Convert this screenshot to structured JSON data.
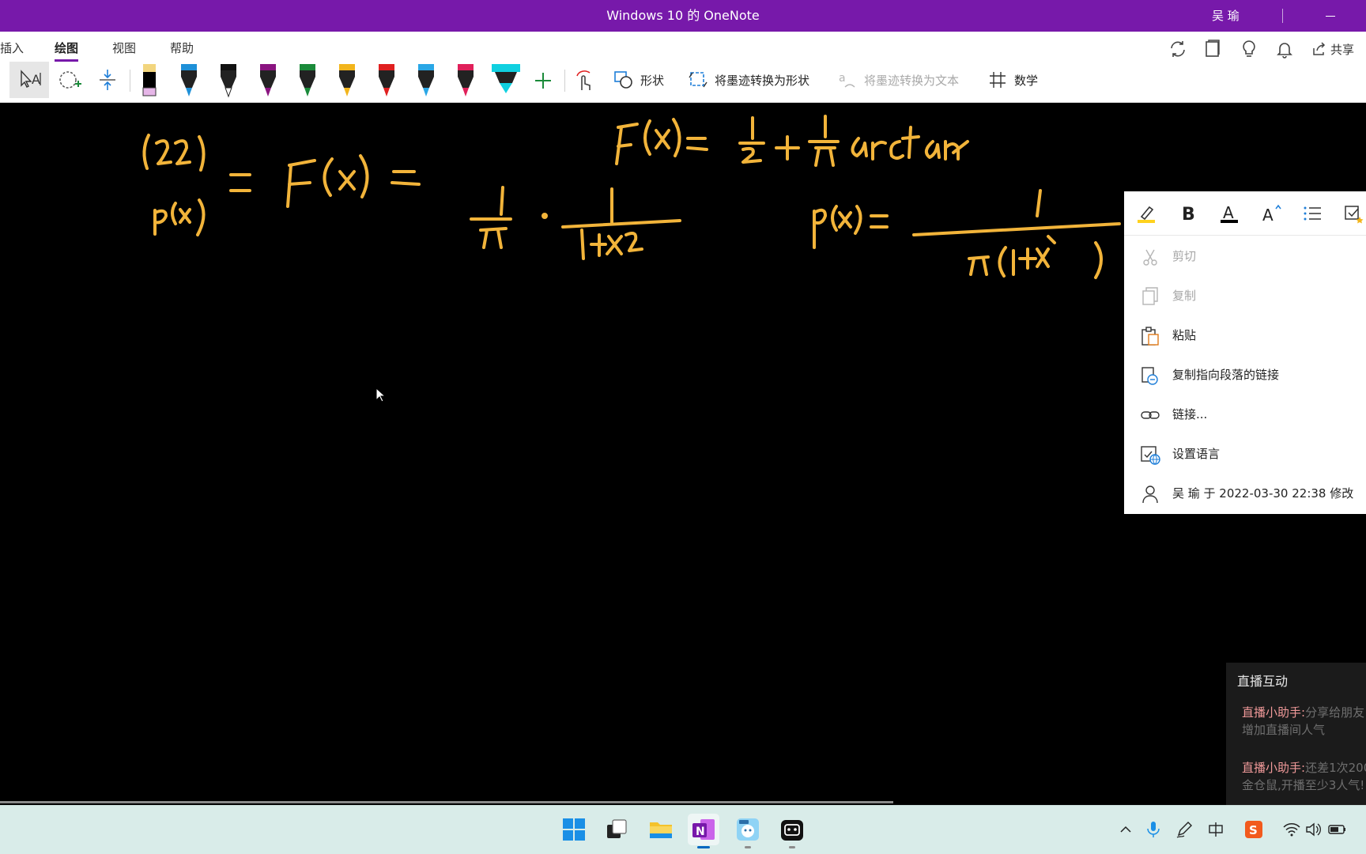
{
  "window": {
    "title": "Windows 10 的 OneNote",
    "user": "吴 瑜"
  },
  "ribbon": {
    "tabs": [
      {
        "label": "插入"
      },
      {
        "label": "绘图",
        "active": true
      },
      {
        "label": "视图"
      },
      {
        "label": "帮助"
      }
    ],
    "share_label": "共享",
    "commands": {
      "shapes": "形状",
      "ink_to_shape": "将墨迹转换为形状",
      "ink_to_text": "将墨迹转换为文本",
      "math": "数学"
    },
    "pens": [
      {
        "name": "black-highlighter-pen",
        "color": "#000000",
        "cap": "#f3c7e6"
      },
      {
        "name": "blue-pen",
        "color": "#1e90d8"
      },
      {
        "name": "black-pen",
        "color": "#111111"
      },
      {
        "name": "purple-pen",
        "color": "#8a1480"
      },
      {
        "name": "green-pen",
        "color": "#1a8a3a"
      },
      {
        "name": "yellow-pen",
        "color": "#f2b51c"
      },
      {
        "name": "red-pen",
        "color": "#e02020"
      },
      {
        "name": "light-blue-pen",
        "color": "#2aa7e6"
      },
      {
        "name": "pink-pen",
        "color": "#e0205a"
      },
      {
        "name": "cyan-highlighter",
        "color": "#10d0e0"
      }
    ],
    "accent_color": "#7719aa"
  },
  "canvas": {
    "ink_color": "#f2b43a",
    "background": "#000000"
  },
  "context_menu": {
    "items": [
      {
        "label": "剪切",
        "icon": "scissors-icon",
        "disabled": true
      },
      {
        "label": "复制",
        "icon": "copy-icon",
        "disabled": true
      },
      {
        "label": "粘贴",
        "icon": "paste-icon",
        "disabled": false
      },
      {
        "label": "复制指向段落的链接",
        "icon": "copy-link-icon",
        "disabled": false
      },
      {
        "label": "链接...",
        "icon": "link-icon",
        "disabled": false
      },
      {
        "label": "设置语言",
        "icon": "language-icon",
        "disabled": false
      },
      {
        "label": "吴 瑜 于 2022-03-30 22:38 修改",
        "icon": "person-icon",
        "disabled": false
      }
    ]
  },
  "live_panel": {
    "title": "直播互动",
    "messages": [
      {
        "sender": "直播小助手:",
        "text": "分享给朋友增加直播间人气"
      },
      {
        "sender": "直播小助手:",
        "text": "还差1次200金仓鼠,开播至少3人气!"
      }
    ]
  }
}
